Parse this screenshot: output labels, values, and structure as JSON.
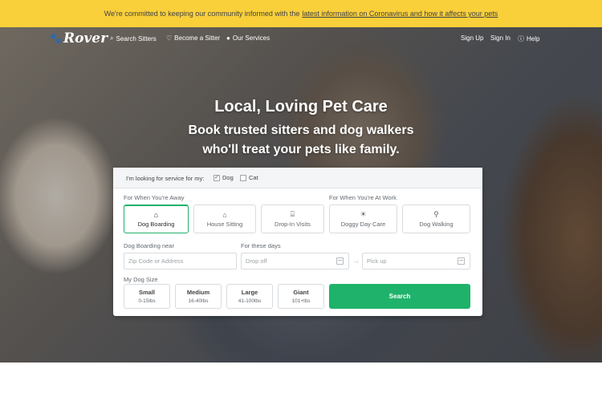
{
  "banner": {
    "text": "We're committed to keeping our community informed with the",
    "link": "latest information on Coronavirus and how it affects your pets"
  },
  "nav": {
    "logo": "Rover",
    "search_sitters": "Search Sitters",
    "become_sitter": "Become a Sitter",
    "our_services": "Our Services",
    "sign_up": "Sign Up",
    "sign_in": "Sign In",
    "help": "Help"
  },
  "hero": {
    "title": "Local, Loving Pet Care",
    "subtitle_line1": "Book trusted sitters and dog walkers",
    "subtitle_line2": "who'll treat your pets like family."
  },
  "search": {
    "looking_for": "I'm looking for service for my:",
    "pet_dog": "Dog",
    "pet_cat": "Cat",
    "dog_checked": true,
    "cat_checked": false,
    "away_label": "For When You're Away",
    "work_label": "For When You're At Work",
    "services": [
      {
        "label": "Dog Boarding",
        "icon": "house-icon",
        "selected": true
      },
      {
        "label": "House Sitting",
        "icon": "home-icon",
        "selected": false
      },
      {
        "label": "Drop-In Visits",
        "icon": "door-icon",
        "selected": false
      },
      {
        "label": "Doggy Day Care",
        "icon": "sun-icon",
        "selected": false
      },
      {
        "label": "Dog Walking",
        "icon": "leash-icon",
        "selected": false
      }
    ],
    "near_label": "Dog Boarding near",
    "zip_placeholder": "Zip Code or Address",
    "days_label": "For these days",
    "dropoff_placeholder": "Drop off",
    "pickup_placeholder": "Pick up",
    "size_label": "My Dog Size",
    "sizes": [
      {
        "name": "Small",
        "weight": "0-15lbs"
      },
      {
        "name": "Medium",
        "weight": "16-40lbs"
      },
      {
        "name": "Large",
        "weight": "41-100lbs"
      },
      {
        "name": "Giant",
        "weight": "101+lbs"
      }
    ],
    "search_button": "Search"
  },
  "colors": {
    "banner": "#f9cf3a",
    "accent": "#1fb26b"
  }
}
